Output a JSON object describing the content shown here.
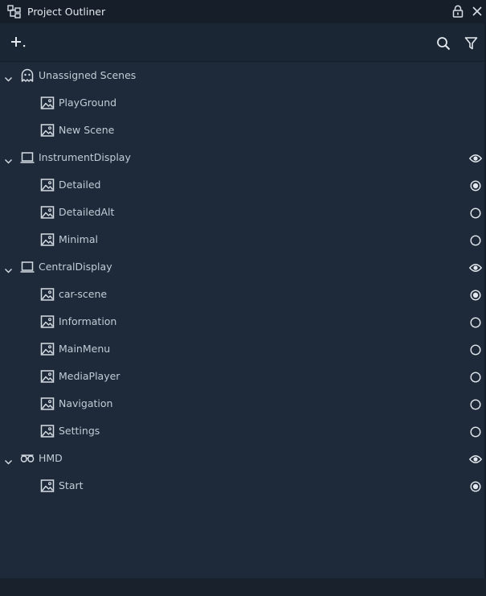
{
  "window": {
    "title": "Project Outliner"
  },
  "colors": {
    "background": "#1e2a39",
    "titlebar": "#151e29",
    "text": "#c3ccd7",
    "icon": "#d7dde5"
  },
  "tree": [
    {
      "kind": "group",
      "label": "Unassigned Scenes",
      "icon": "ghost-icon",
      "state": "none"
    },
    {
      "kind": "scene",
      "label": "PlayGround",
      "state": "none"
    },
    {
      "kind": "scene",
      "label": "New Scene",
      "state": "none"
    },
    {
      "kind": "group",
      "label": "InstrumentDisplay",
      "icon": "monitor-icon",
      "state": "eye"
    },
    {
      "kind": "scene",
      "label": "Detailed",
      "state": "on"
    },
    {
      "kind": "scene",
      "label": "DetailedAlt",
      "state": "off"
    },
    {
      "kind": "scene",
      "label": "Minimal",
      "state": "off"
    },
    {
      "kind": "group",
      "label": "CentralDisplay",
      "icon": "monitor-icon",
      "state": "eye"
    },
    {
      "kind": "scene",
      "label": "car-scene",
      "state": "on"
    },
    {
      "kind": "scene",
      "label": "Information",
      "state": "off"
    },
    {
      "kind": "scene",
      "label": "MainMenu",
      "state": "off"
    },
    {
      "kind": "scene",
      "label": "MediaPlayer",
      "state": "off"
    },
    {
      "kind": "scene",
      "label": "Navigation",
      "state": "off"
    },
    {
      "kind": "scene",
      "label": "Settings",
      "state": "off"
    },
    {
      "kind": "group",
      "label": "HMD",
      "icon": "vr-headset-icon",
      "state": "eye"
    },
    {
      "kind": "scene",
      "label": "Start",
      "state": "on"
    }
  ]
}
